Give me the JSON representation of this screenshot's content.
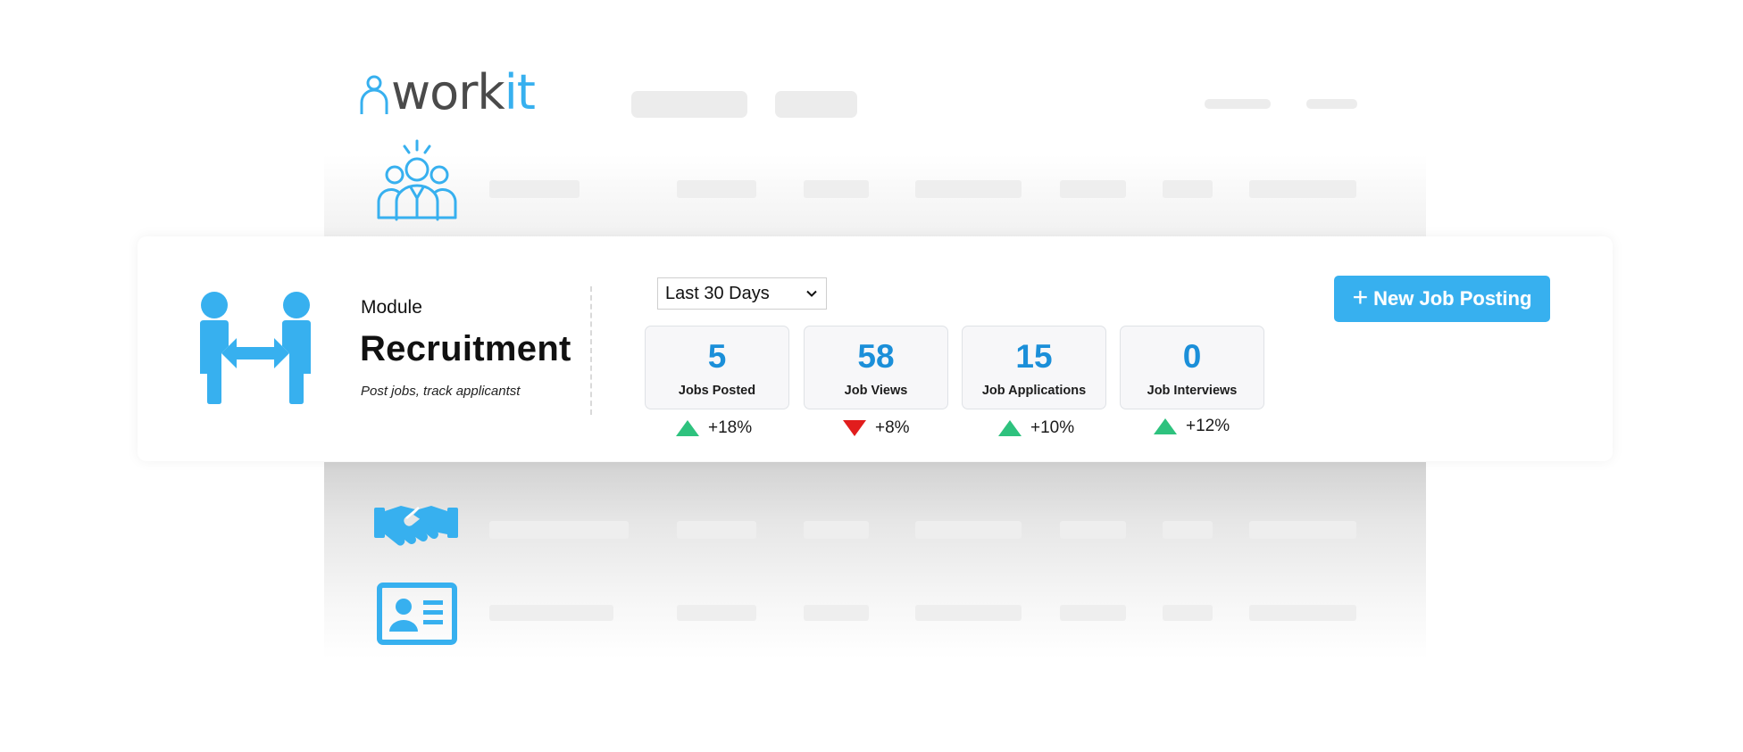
{
  "brand": {
    "logo_text_main": "work",
    "logo_text_accent": "it",
    "accent_color": "#37b0ef"
  },
  "module": {
    "label": "Module",
    "title": "Recruitment",
    "subtitle": "Post jobs, track applicantst",
    "icon": "recruitment-exchange-icon"
  },
  "filter": {
    "range_value": "Last 30 Days"
  },
  "stats": [
    {
      "value": "5",
      "label": "Jobs Posted",
      "trend": "+18%",
      "direction": "up"
    },
    {
      "value": "58",
      "label": "Job Views",
      "trend": "+8%",
      "direction": "down"
    },
    {
      "value": "15",
      "label": "Job Applications",
      "trend": "+10%",
      "direction": "up"
    },
    {
      "value": "0",
      "label": "Job Interviews",
      "trend": "+12%",
      "direction": "up"
    }
  ],
  "actions": {
    "new_job_plus": "+",
    "new_job_label": "New Job Posting"
  },
  "background_icons": [
    "team-icon",
    "handshake-icon",
    "id-card-icon"
  ],
  "colors": {
    "stat_value": "#1b8fd9",
    "trend_up": "#2ec27e",
    "trend_down": "#e11d1d"
  }
}
